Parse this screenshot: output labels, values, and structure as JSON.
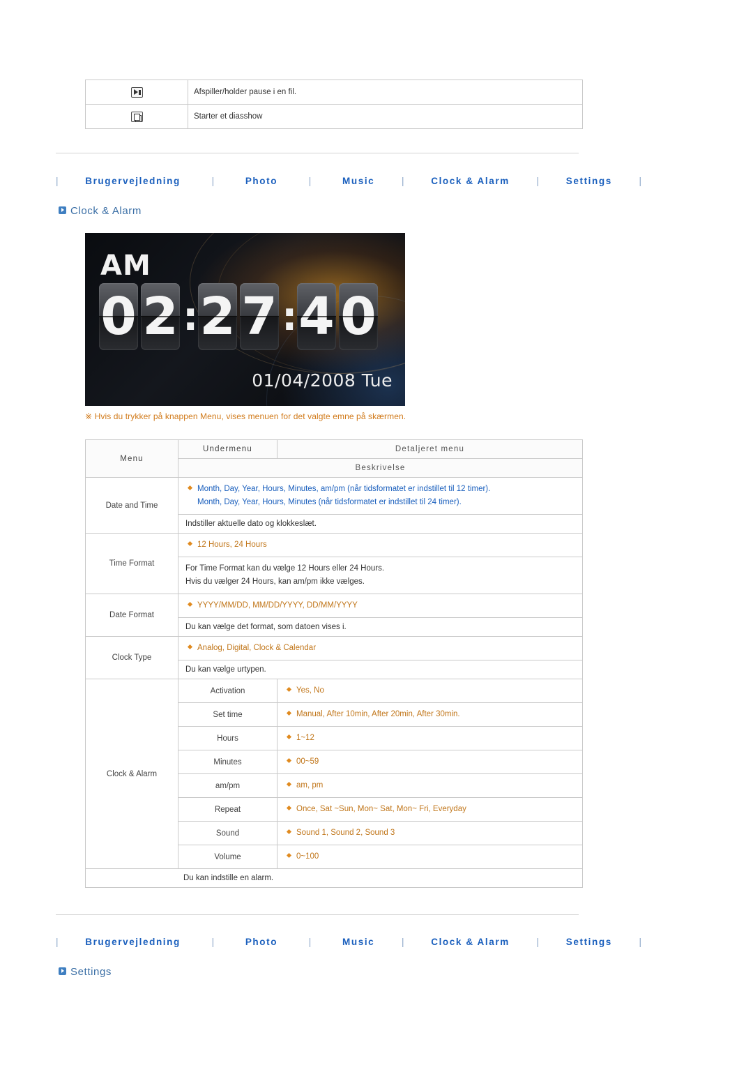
{
  "top_table": {
    "rows": [
      {
        "icon": "play-pause-icon",
        "text": "Afspiller/holder pause i en fil."
      },
      {
        "icon": "slideshow-icon",
        "text": "Starter et diasshow"
      }
    ]
  },
  "nav": {
    "separator": "|",
    "items": [
      {
        "label": "Brugervejledning"
      },
      {
        "label": "Photo"
      },
      {
        "label": "Music"
      },
      {
        "label": "Clock & Alarm"
      },
      {
        "label": "Settings"
      }
    ]
  },
  "headings": {
    "clock_alarm": "Clock & Alarm",
    "settings": "Settings"
  },
  "clock_image": {
    "ampm": "AM",
    "digits": [
      "0",
      "2",
      "2",
      "7",
      "4",
      "0"
    ],
    "colon": ":",
    "date": "01/04/2008 Tue"
  },
  "note": "※ Hvis du trykker på knappen Menu, vises menuen for det valgte emne på skærmen.",
  "table": {
    "headers": {
      "menu": "Menu",
      "undermenu": "Undermenu",
      "detail": "Detaljeret menu",
      "description": "Beskrivelse"
    },
    "sections": [
      {
        "menu": "Date and Time",
        "detail_lines": [
          "Month, Day, Year, Hours, Minutes, am/pm (når tidsformatet er indstillet til 12 timer).",
          "Month, Day, Year, Hours, Minutes (når tidsformatet er indstillet til 24 timer)."
        ],
        "description_lines": [
          "Indstiller aktuelle dato og klokkeslæt."
        ]
      },
      {
        "menu": "Time Format",
        "detail_lines": [
          "12 Hours, 24 Hours"
        ],
        "description_lines": [
          "For Time Format kan du vælge 12 Hours eller 24 Hours.",
          "Hvis du vælger 24 Hours, kan am/pm ikke vælges."
        ]
      },
      {
        "menu": "Date Format",
        "detail_lines": [
          "YYYY/MM/DD, MM/DD/YYYY, DD/MM/YYYY"
        ],
        "description_lines": [
          "Du kan vælge det format, som datoen vises i."
        ]
      },
      {
        "menu": "Clock Type",
        "detail_lines": [
          "Analog, Digital, Clock & Calendar"
        ],
        "description_lines": [
          "Du kan vælge urtypen."
        ]
      }
    ],
    "alarm_section": {
      "menu": "Clock & Alarm",
      "rows": [
        {
          "submenu": "Activation",
          "detail": "Yes, No"
        },
        {
          "submenu": "Set time",
          "detail": "Manual, After 10min, After 20min, After 30min."
        },
        {
          "submenu": "Hours",
          "detail": "1~12"
        },
        {
          "submenu": "Minutes",
          "detail": "00~59"
        },
        {
          "submenu": "am/pm",
          "detail": "am, pm"
        },
        {
          "submenu": "Repeat",
          "detail": "Once, Sat ~Sun, Mon~ Sat, Mon~ Fri, Everyday"
        },
        {
          "submenu": "Sound",
          "detail": "Sound 1, Sound 2, Sound 3"
        },
        {
          "submenu": "Volume",
          "detail": "0~100"
        }
      ],
      "description": "Du kan indstille en alarm."
    }
  },
  "colors": {
    "link_blue": "#1a5fbd",
    "orange": "#c1761a",
    "heading_blue": "#3a6ea5"
  }
}
